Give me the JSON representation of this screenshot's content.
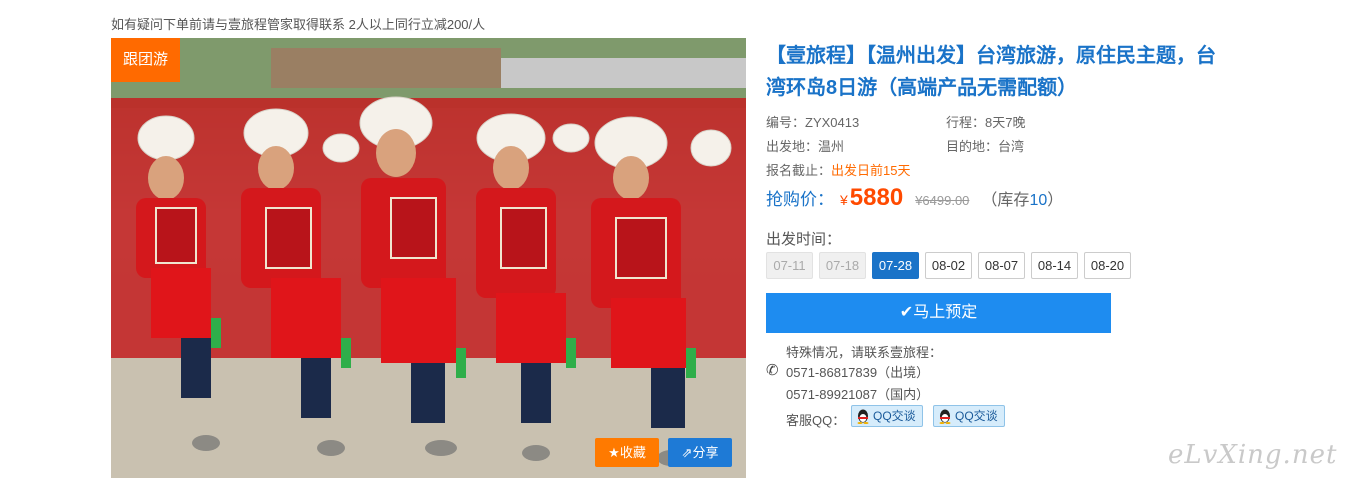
{
  "notice": "如有疑问下单前请与壹旅程管家取得联系 2人以上同行立减200/人",
  "photo": {
    "tag": "跟团游",
    "fav_label": "收藏",
    "share_label": "分享"
  },
  "product": {
    "title": "【壹旅程】【温州出发】台湾旅游，原住民主题，台湾环岛8日游（高端产品无需配额）",
    "code": "编号：ZYX0413",
    "duration": "行程：8天7晚",
    "departure": "出发地：温州",
    "destination": "目的地：台湾",
    "deadline_label": "报名截止：",
    "deadline_value": "出发日前15天"
  },
  "price": {
    "label": "抢购价：",
    "currency": "¥",
    "value": "5880",
    "original": "¥6499.00",
    "stock_prefix": "（库存",
    "stock_value": "10",
    "stock_suffix": "）"
  },
  "dates": {
    "label": "出发时间：",
    "items": [
      {
        "label": "07-11",
        "state": "past"
      },
      {
        "label": "07-18",
        "state": "past"
      },
      {
        "label": "07-28",
        "state": "active"
      },
      {
        "label": "08-02",
        "state": "normal"
      },
      {
        "label": "08-07",
        "state": "normal"
      },
      {
        "label": "08-14",
        "state": "normal"
      },
      {
        "label": "08-20",
        "state": "normal"
      }
    ]
  },
  "book_label": "马上预定",
  "contact": {
    "intro": "特殊情况，请联系壹旅程：",
    "phone1": "0571-86817839（出境）",
    "phone2": "0571-89921087（国内）",
    "qq_label": "客服QQ：",
    "qq_btn1": "QQ交谈",
    "qq_btn2": "QQ交谈"
  },
  "watermark": "eLvXing.net",
  "colors": {
    "brand_blue": "#1a73c8",
    "accent_orange": "#ff6a00",
    "button_blue": "#1e8cf0"
  }
}
